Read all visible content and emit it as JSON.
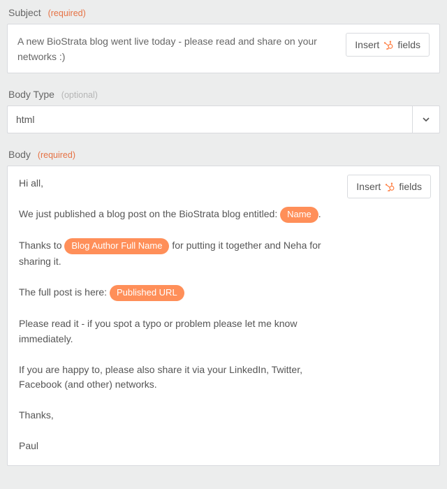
{
  "labels": {
    "subject": "Subject",
    "required": "(required)",
    "bodytype": "Body Type",
    "optional": "(optional)",
    "body": "Body",
    "insert_prefix": "Insert",
    "insert_suffix": "fields"
  },
  "subject": {
    "value": "A new BioStrata blog went live today - please read and share on your networks :)"
  },
  "bodytype": {
    "selected": "html"
  },
  "body": {
    "greeting": "Hi all,",
    "p1_pre": "We just published a blog post on the BioStrata blog entitled: ",
    "p1_chip": "Name",
    "p1_post": ".",
    "p2_pre": "Thanks to ",
    "p2_chip": "Blog Author Full Name",
    "p2_post": " for putting it together and Neha for sharing it.",
    "p3_pre": "The full post is here: ",
    "p3_chip": "Published URL",
    "p3_post": "",
    "p4": "Please read it - if you spot a typo or problem please let me know immediately.",
    "p5": "If you are happy to, please also share it via your LinkedIn, Twitter, Facebook (and other) networks.",
    "thanks": "Thanks,",
    "sign": "Paul"
  }
}
